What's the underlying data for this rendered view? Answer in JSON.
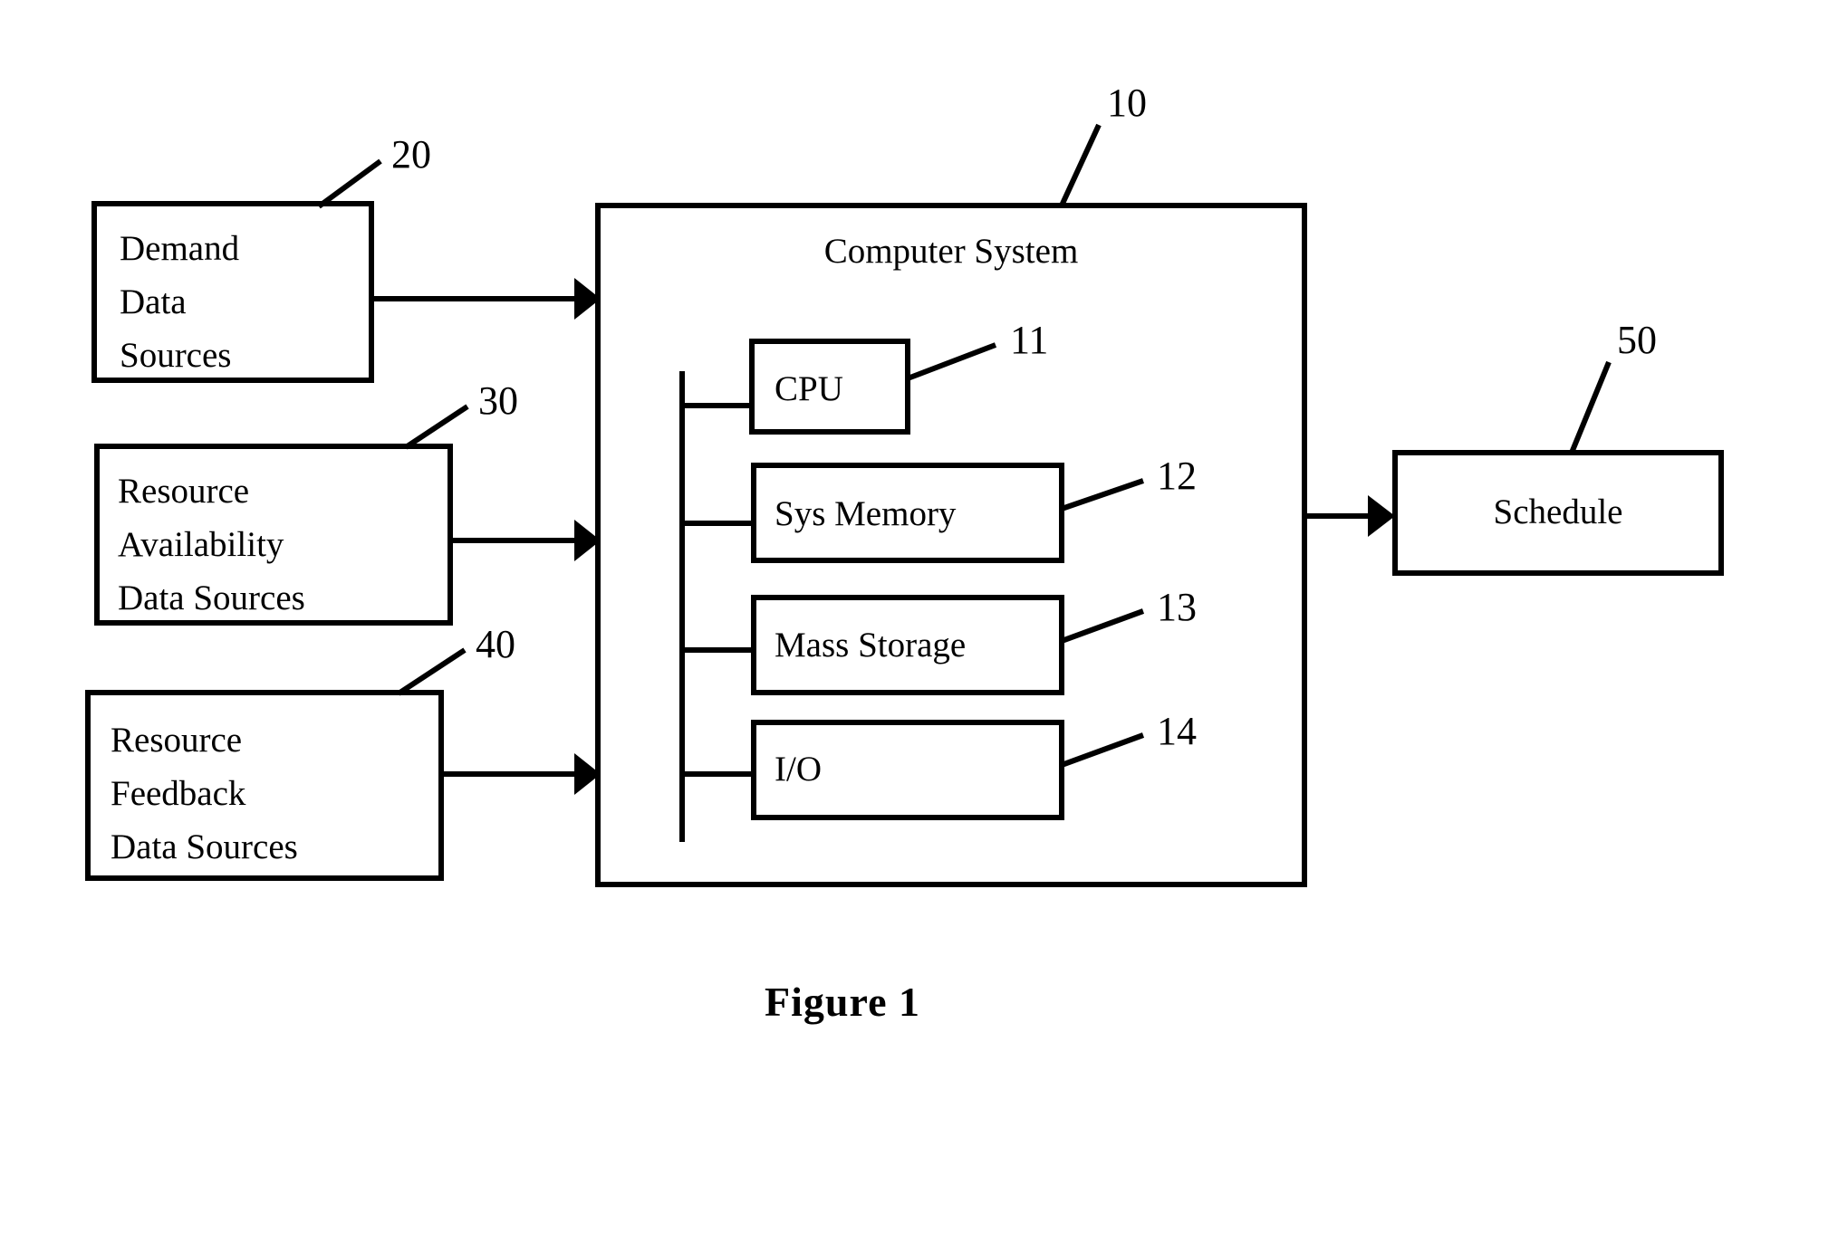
{
  "figure": {
    "caption": "Figure 1"
  },
  "inputs": [
    {
      "id": "demand-data-sources",
      "lines": [
        "Demand",
        "Data",
        "Sources"
      ],
      "ref": "20"
    },
    {
      "id": "resource-availability-data-sources",
      "lines": [
        "Resource",
        "Availability",
        "Data Sources"
      ],
      "ref": "30"
    },
    {
      "id": "resource-feedback-data-sources",
      "lines": [
        "Resource",
        "Feedback",
        "Data Sources"
      ],
      "ref": "40"
    }
  ],
  "computer_system": {
    "title": "Computer System",
    "ref": "10",
    "components": [
      {
        "id": "cpu",
        "label": "CPU",
        "ref": "11"
      },
      {
        "id": "sys-memory",
        "label": "Sys Memory",
        "ref": "12"
      },
      {
        "id": "mass-storage",
        "label": "Mass Storage",
        "ref": "13"
      },
      {
        "id": "io",
        "label": "I/O",
        "ref": "14"
      }
    ]
  },
  "output": {
    "id": "schedule",
    "label": "Schedule",
    "ref": "50"
  },
  "colors": {
    "stroke": "#000000",
    "background": "#ffffff"
  }
}
